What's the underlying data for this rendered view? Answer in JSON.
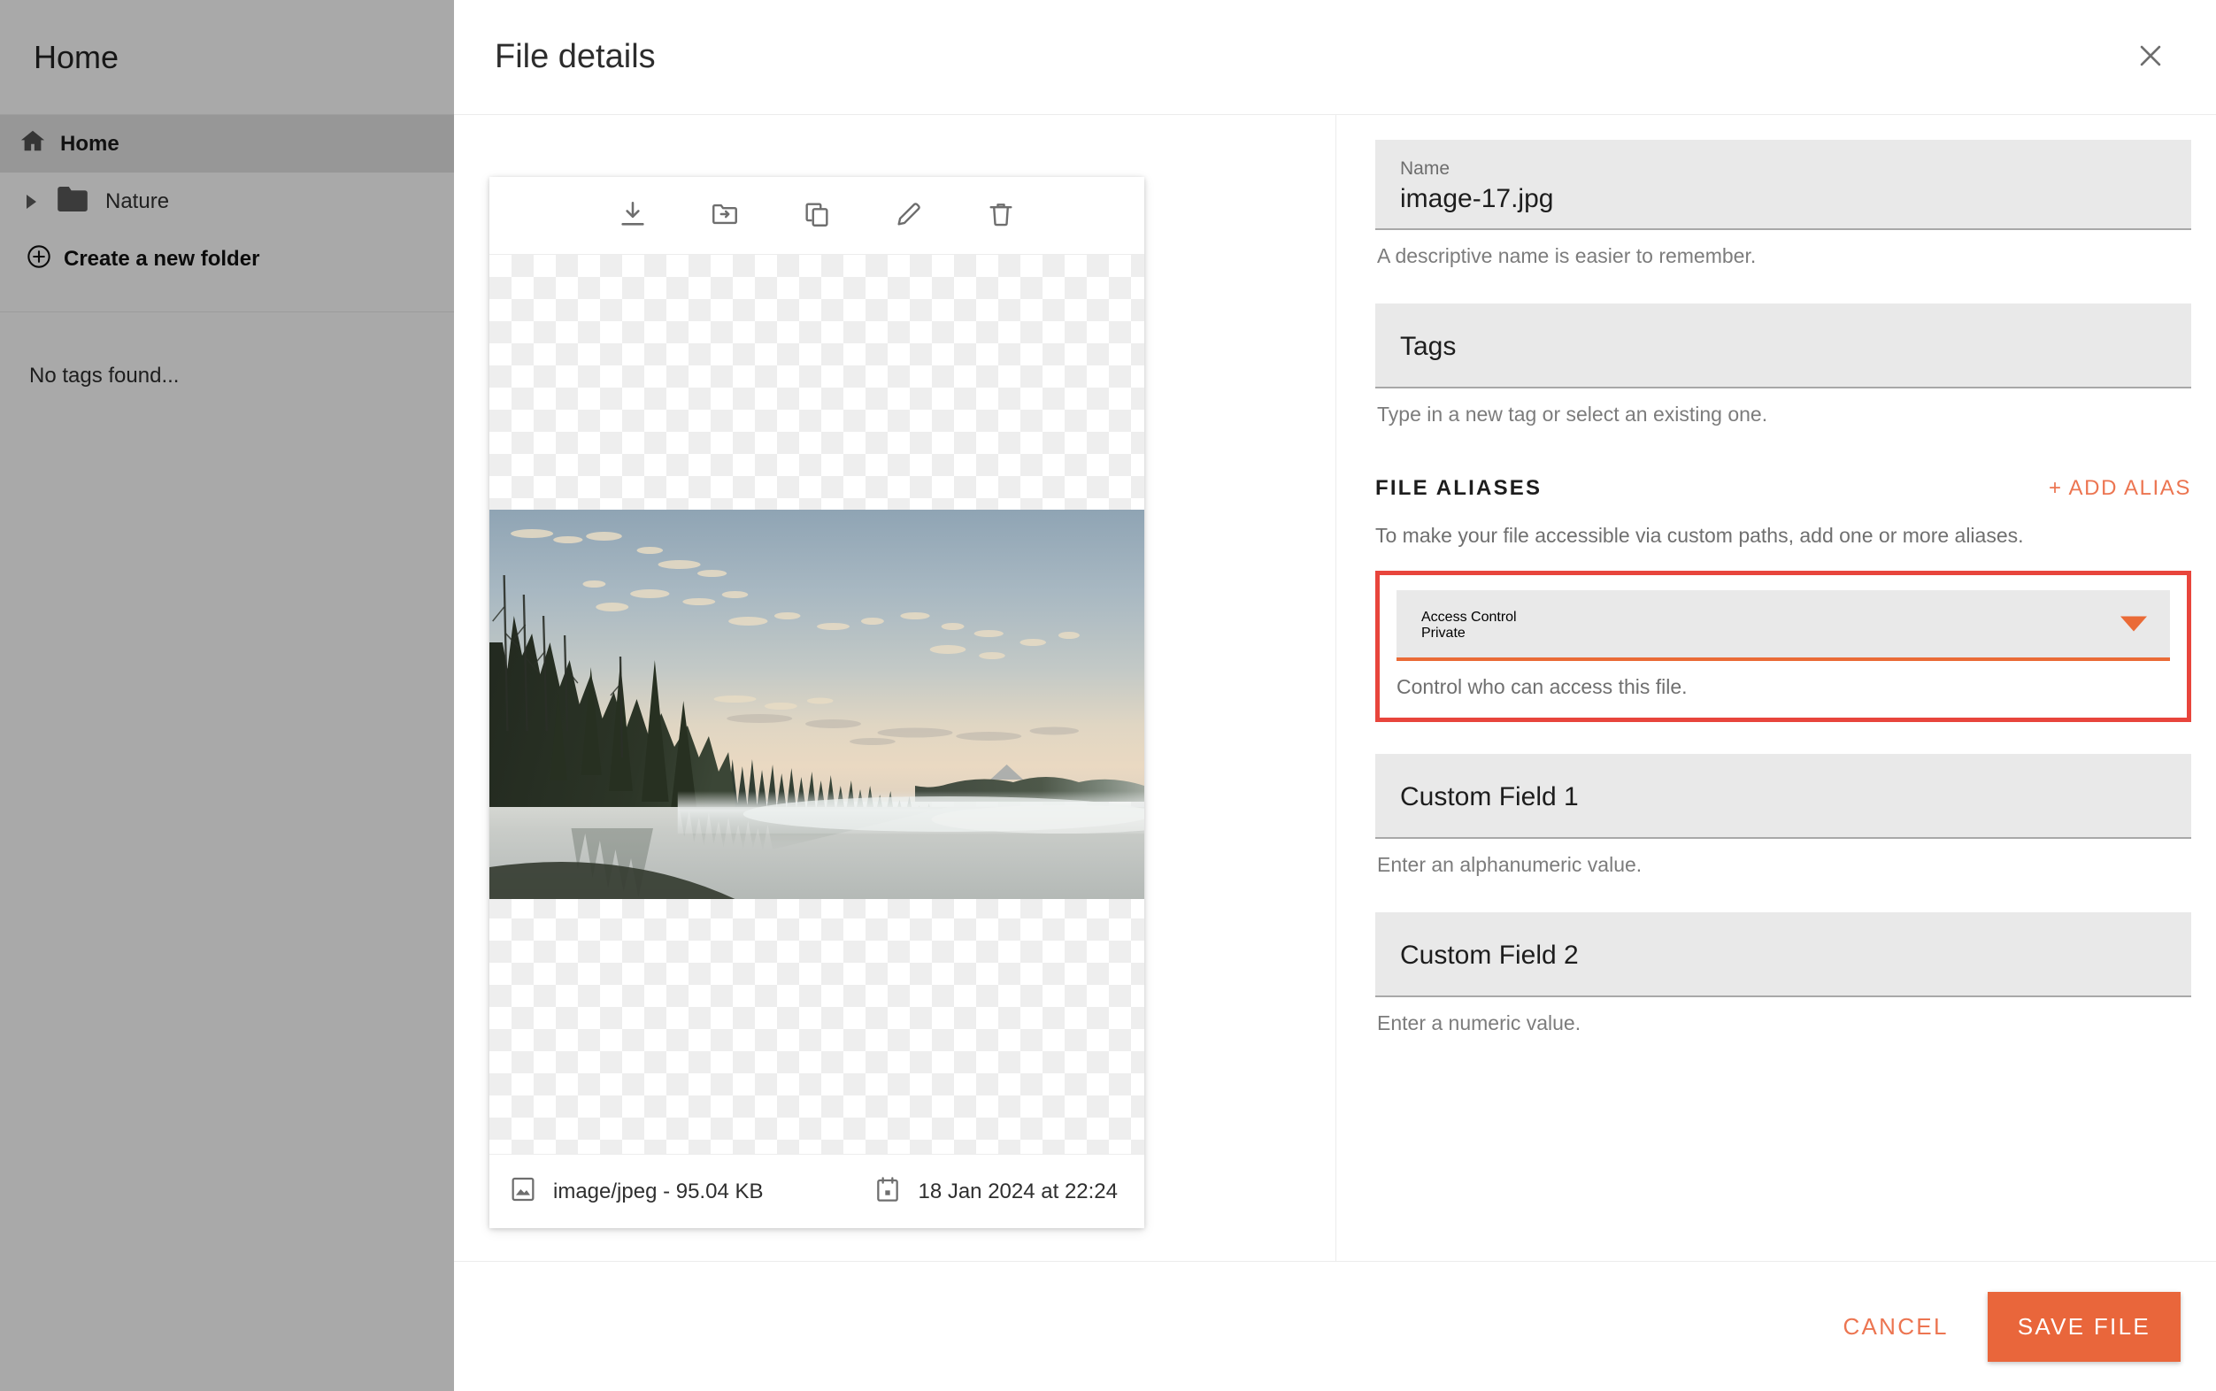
{
  "sidebar": {
    "header_title": "Home",
    "items": [
      {
        "label": "Home",
        "icon": "home-icon",
        "active": true
      },
      {
        "label": "Nature",
        "icon": "folder-icon",
        "active": false
      }
    ],
    "create_folder_label": "Create a new folder",
    "tags_empty_text": "No tags found..."
  },
  "dialog": {
    "title": "File details",
    "close_icon": "close-icon"
  },
  "preview": {
    "toolbar": [
      {
        "name": "download-icon",
        "label": "Download"
      },
      {
        "name": "move-to-folder-icon",
        "label": "Move"
      },
      {
        "name": "copy-icon",
        "label": "Copy"
      },
      {
        "name": "edit-pencil-icon",
        "label": "Edit"
      },
      {
        "name": "delete-trash-icon",
        "label": "Delete"
      }
    ],
    "image_alt": "Misty lake at dawn with conifer forest",
    "mime_and_size": "image/jpeg - 95.04 KB",
    "date_modified": "18 Jan 2024 at 22:24",
    "mime_icon": "image-icon",
    "date_icon": "calendar-icon"
  },
  "form": {
    "name_field": {
      "label": "Name",
      "value": "image-17.jpg",
      "help": "A descriptive name is easier to remember."
    },
    "tags_field": {
      "placeholder": "Tags",
      "value": "",
      "help": "Type in a new tag or select an existing one."
    },
    "aliases_section": {
      "title": "FILE ALIASES",
      "action_label": "+ ADD ALIAS",
      "description": "To make your file accessible via custom paths, add one or more aliases."
    },
    "access_control": {
      "label": "Access Control",
      "value": "Private",
      "help": "Control who can access this file.",
      "caret_icon": "chevron-down-icon",
      "highlighted": true
    },
    "custom_field_1": {
      "placeholder": "Custom Field 1",
      "value": "",
      "help": "Enter an alphanumeric value."
    },
    "custom_field_2": {
      "placeholder": "Custom Field 2",
      "value": "",
      "help": "Enter a numeric value."
    }
  },
  "footer": {
    "cancel_label": "CANCEL",
    "save_label": "SAVE FILE"
  },
  "colors": {
    "accent_orange": "#e9663b",
    "accent_orange_light": "#ec7551",
    "highlight_red": "#e8453c",
    "field_bg": "#e9e9e9",
    "sidebar_bg": "#f2f2f2"
  }
}
